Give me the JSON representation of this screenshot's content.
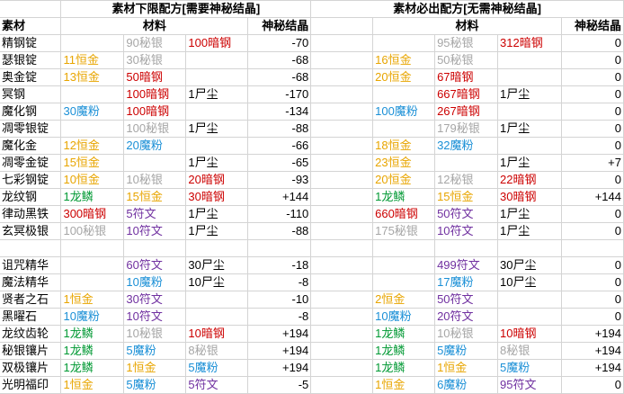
{
  "headers": {
    "material": "素材",
    "lower_title": "素材下限配方[需要神秘结晶]",
    "sure_title": "素材必出配方[无需神秘结晶]",
    "ingredients": "材料",
    "crystal": "神秘结晶"
  },
  "colors": {
    "gold": "#e8a500",
    "silver": "#a6a6a6",
    "red": "#cc0000",
    "blue": "#1a8fd6",
    "purple": "#7030a0",
    "green": "#009933",
    "black": "#000000"
  },
  "groups": [
    {
      "name": "ingots",
      "rows": [
        {
          "name": "精钢锭",
          "a": [
            {
              "t": "",
              "c": ""
            },
            {
              "t": "90秘银",
              "c": "silver"
            },
            {
              "t": "100暗钢",
              "c": "red"
            }
          ],
          "av": "-70",
          "b": [
            {
              "t": "",
              "c": ""
            },
            {
              "t": "95秘银",
              "c": "silver"
            },
            {
              "t": "312暗钢",
              "c": "red"
            }
          ],
          "bv": "0"
        },
        {
          "name": "瑟银锭",
          "a": [
            {
              "t": "11恒金",
              "c": "gold"
            },
            {
              "t": "30秘银",
              "c": "silver"
            },
            {
              "t": "",
              "c": ""
            }
          ],
          "av": "-68",
          "b": [
            {
              "t": "16恒金",
              "c": "gold"
            },
            {
              "t": "50秘银",
              "c": "silver"
            },
            {
              "t": "",
              "c": ""
            }
          ],
          "bv": "0"
        },
        {
          "name": "奥金锭",
          "a": [
            {
              "t": "13恒金",
              "c": "gold"
            },
            {
              "t": "50暗钢",
              "c": "red"
            },
            {
              "t": "",
              "c": ""
            }
          ],
          "av": "-68",
          "b": [
            {
              "t": "20恒金",
              "c": "gold"
            },
            {
              "t": "67暗钢",
              "c": "red"
            },
            {
              "t": "",
              "c": ""
            }
          ],
          "bv": "0"
        },
        {
          "name": "冥钢",
          "a": [
            {
              "t": "",
              "c": ""
            },
            {
              "t": "100暗钢",
              "c": "red"
            },
            {
              "t": "1尸尘",
              "c": "black"
            }
          ],
          "av": "-170",
          "b": [
            {
              "t": "",
              "c": ""
            },
            {
              "t": "667暗钢",
              "c": "red"
            },
            {
              "t": "1尸尘",
              "c": "black"
            }
          ],
          "bv": "0"
        },
        {
          "name": "魔化钢",
          "a": [
            {
              "t": "30魔粉",
              "c": "blue"
            },
            {
              "t": "100暗钢",
              "c": "red"
            },
            {
              "t": "",
              "c": ""
            }
          ],
          "av": "-134",
          "b": [
            {
              "t": "100魔粉",
              "c": "blue"
            },
            {
              "t": "267暗钢",
              "c": "red"
            },
            {
              "t": "",
              "c": ""
            }
          ],
          "bv": "0"
        },
        {
          "name": "凋零银锭",
          "a": [
            {
              "t": "",
              "c": ""
            },
            {
              "t": "100秘银",
              "c": "silver"
            },
            {
              "t": "1尸尘",
              "c": "black"
            }
          ],
          "av": "-88",
          "b": [
            {
              "t": "",
              "c": ""
            },
            {
              "t": "179秘银",
              "c": "silver"
            },
            {
              "t": "1尸尘",
              "c": "black"
            }
          ],
          "bv": "0"
        },
        {
          "name": "魔化金",
          "a": [
            {
              "t": "12恒金",
              "c": "gold"
            },
            {
              "t": "20魔粉",
              "c": "blue"
            },
            {
              "t": "",
              "c": ""
            }
          ],
          "av": "-66",
          "b": [
            {
              "t": "18恒金",
              "c": "gold"
            },
            {
              "t": "32魔粉",
              "c": "blue"
            },
            {
              "t": "",
              "c": ""
            }
          ],
          "bv": "0"
        },
        {
          "name": "凋零金锭",
          "a": [
            {
              "t": "15恒金",
              "c": "gold"
            },
            {
              "t": "",
              "c": ""
            },
            {
              "t": "1尸尘",
              "c": "black"
            }
          ],
          "av": "-65",
          "b": [
            {
              "t": "23恒金",
              "c": "gold"
            },
            {
              "t": "",
              "c": ""
            },
            {
              "t": "1尸尘",
              "c": "black"
            }
          ],
          "bv": "+7"
        },
        {
          "name": "七彩钢锭",
          "a": [
            {
              "t": "10恒金",
              "c": "gold"
            },
            {
              "t": "10秘银",
              "c": "silver"
            },
            {
              "t": "20暗钢",
              "c": "red"
            }
          ],
          "av": "-93",
          "b": [
            {
              "t": "20恒金",
              "c": "gold"
            },
            {
              "t": "12秘银",
              "c": "silver"
            },
            {
              "t": "22暗钢",
              "c": "red"
            }
          ],
          "bv": "0"
        },
        {
          "name": "龙纹钢",
          "a": [
            {
              "t": "1龙鳞",
              "c": "green"
            },
            {
              "t": "15恒金",
              "c": "gold"
            },
            {
              "t": "30暗钢",
              "c": "red"
            }
          ],
          "av": "+144",
          "b": [
            {
              "t": "1龙鳞",
              "c": "green"
            },
            {
              "t": "15恒金",
              "c": "gold"
            },
            {
              "t": "30暗钢",
              "c": "red"
            }
          ],
          "bv": "+144"
        },
        {
          "name": "律动黑铁",
          "a": [
            {
              "t": "300暗钢",
              "c": "red"
            },
            {
              "t": "5符文",
              "c": "purple"
            },
            {
              "t": "1尸尘",
              "c": "black"
            }
          ],
          "av": "-110",
          "b": [
            {
              "t": "660暗钢",
              "c": "red"
            },
            {
              "t": "50符文",
              "c": "purple"
            },
            {
              "t": "1尸尘",
              "c": "black"
            }
          ],
          "bv": "0"
        },
        {
          "name": "玄冥极银",
          "a": [
            {
              "t": "100秘银",
              "c": "silver"
            },
            {
              "t": "10符文",
              "c": "purple"
            },
            {
              "t": "1尸尘",
              "c": "black"
            }
          ],
          "av": "-88",
          "b": [
            {
              "t": "175秘银",
              "c": "silver"
            },
            {
              "t": "10符文",
              "c": "purple"
            },
            {
              "t": "1尸尘",
              "c": "black"
            }
          ],
          "bv": "0"
        }
      ]
    },
    {
      "name": "essences",
      "rows": [
        {
          "name": "诅咒精华",
          "a": [
            {
              "t": "",
              "c": ""
            },
            {
              "t": "60符文",
              "c": "purple"
            },
            {
              "t": "30尸尘",
              "c": "black"
            }
          ],
          "av": "-18",
          "b": [
            {
              "t": "",
              "c": ""
            },
            {
              "t": "499符文",
              "c": "purple"
            },
            {
              "t": "30尸尘",
              "c": "black"
            }
          ],
          "bv": "0"
        },
        {
          "name": "魔法精华",
          "a": [
            {
              "t": "",
              "c": ""
            },
            {
              "t": "10魔粉",
              "c": "blue"
            },
            {
              "t": "10尸尘",
              "c": "black"
            }
          ],
          "av": "-8",
          "b": [
            {
              "t": "",
              "c": ""
            },
            {
              "t": "17魔粉",
              "c": "blue"
            },
            {
              "t": "10尸尘",
              "c": "black"
            }
          ],
          "bv": "0"
        },
        {
          "name": "贤者之石",
          "a": [
            {
              "t": "1恒金",
              "c": "gold"
            },
            {
              "t": "30符文",
              "c": "purple"
            },
            {
              "t": "",
              "c": ""
            }
          ],
          "av": "-10",
          "b": [
            {
              "t": "2恒金",
              "c": "gold"
            },
            {
              "t": "50符文",
              "c": "purple"
            },
            {
              "t": "",
              "c": ""
            }
          ],
          "bv": "0"
        },
        {
          "name": "黑曜石",
          "a": [
            {
              "t": "10魔粉",
              "c": "blue"
            },
            {
              "t": "10符文",
              "c": "purple"
            },
            {
              "t": "",
              "c": ""
            }
          ],
          "av": "-8",
          "b": [
            {
              "t": "10魔粉",
              "c": "blue"
            },
            {
              "t": "20符文",
              "c": "purple"
            },
            {
              "t": "",
              "c": ""
            }
          ],
          "bv": "0"
        },
        {
          "name": "龙纹齿轮",
          "a": [
            {
              "t": "1龙鳞",
              "c": "green"
            },
            {
              "t": "10秘银",
              "c": "silver"
            },
            {
              "t": "10暗钢",
              "c": "red"
            }
          ],
          "av": "+194",
          "b": [
            {
              "t": "1龙鳞",
              "c": "green"
            },
            {
              "t": "10秘银",
              "c": "silver"
            },
            {
              "t": "10暗钢",
              "c": "red"
            }
          ],
          "bv": "+194"
        },
        {
          "name": "秘银镶片",
          "a": [
            {
              "t": "1龙鳞",
              "c": "green"
            },
            {
              "t": "5魔粉",
              "c": "blue"
            },
            {
              "t": "8秘银",
              "c": "silver"
            }
          ],
          "av": "+194",
          "b": [
            {
              "t": "1龙鳞",
              "c": "green"
            },
            {
              "t": "5魔粉",
              "c": "blue"
            },
            {
              "t": "8秘银",
              "c": "silver"
            }
          ],
          "bv": "+194"
        },
        {
          "name": "双极镶片",
          "a": [
            {
              "t": "1龙鳞",
              "c": "green"
            },
            {
              "t": "1恒金",
              "c": "gold"
            },
            {
              "t": "5魔粉",
              "c": "blue"
            }
          ],
          "av": "+194",
          "b": [
            {
              "t": "1龙鳞",
              "c": "green"
            },
            {
              "t": "1恒金",
              "c": "gold"
            },
            {
              "t": "5魔粉",
              "c": "blue"
            }
          ],
          "bv": "+194"
        },
        {
          "name": "光明福印",
          "a": [
            {
              "t": "1恒金",
              "c": "gold"
            },
            {
              "t": "5魔粉",
              "c": "blue"
            },
            {
              "t": "5符文",
              "c": "purple"
            }
          ],
          "av": "-5",
          "b": [
            {
              "t": "1恒金",
              "c": "gold"
            },
            {
              "t": "6魔粉",
              "c": "blue"
            },
            {
              "t": "95符文",
              "c": "purple"
            }
          ],
          "bv": "0"
        }
      ]
    }
  ]
}
